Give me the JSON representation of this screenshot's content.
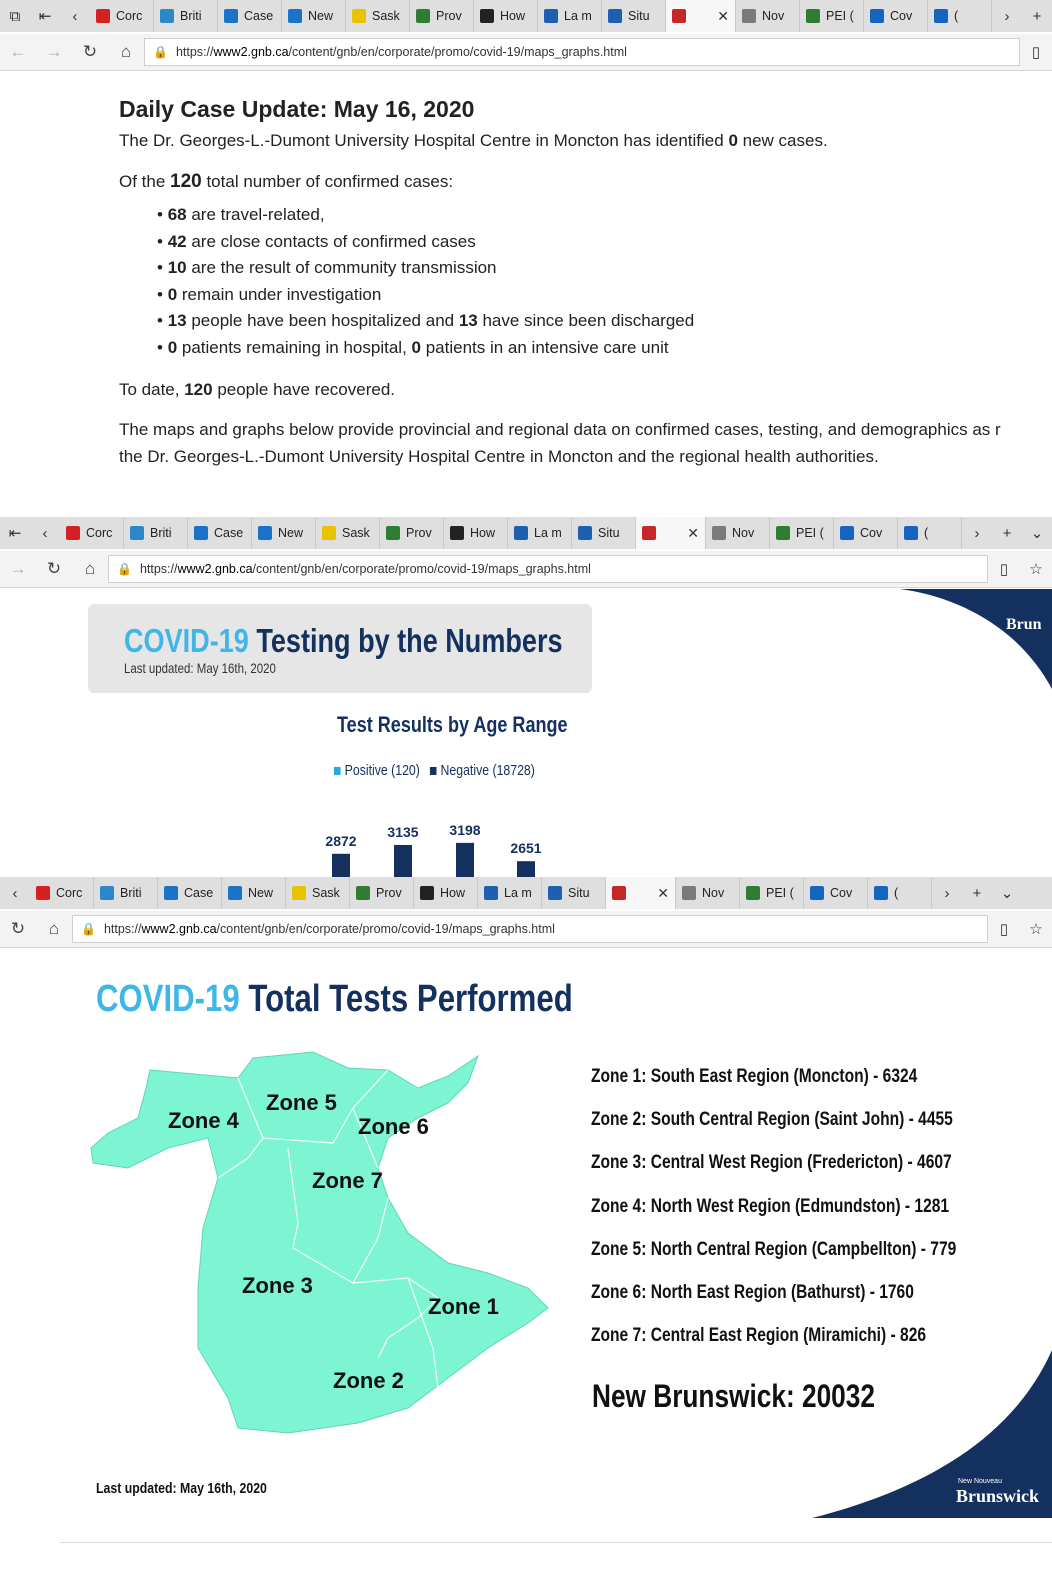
{
  "browser": {
    "tabs": [
      {
        "label": "Corc",
        "color": "#d42020"
      },
      {
        "label": "Briti",
        "color": "#2a88c8"
      },
      {
        "label": "Case",
        "color": "#1a73c9"
      },
      {
        "label": "New",
        "color": "#1a73c9"
      },
      {
        "label": "Sask",
        "color": "#e8c300"
      },
      {
        "label": "Prov",
        "color": "#2e7d32"
      },
      {
        "label": "How",
        "color": "#222222"
      },
      {
        "label": "La m",
        "color": "#1f5fb0"
      },
      {
        "label": "Situ",
        "color": "#1f5fb0"
      },
      {
        "label": "",
        "color": "#c62828",
        "active": true
      },
      {
        "label": "Nov",
        "color": "#7a7a7a"
      },
      {
        "label": "PEI (",
        "color": "#2e7d32"
      },
      {
        "label": "Cov",
        "color": "#1565c0"
      },
      {
        "label": "(",
        "color": "#1565c0"
      }
    ],
    "url_prefix": "https://",
    "url_domain": "www2.gnb.ca",
    "url_path": "/content/gnb/en/corporate/promo/covid-19/maps_graphs.html"
  },
  "update": {
    "heading": "Daily Case Update: May 16, 2020",
    "p1_a": "The Dr. Georges-L.-Dumont University Hospital Centre in Moncton has identified ",
    "p1_b": "0",
    "p1_c": " new cases.",
    "p2_a": "Of the ",
    "p2_b": "120",
    "p2_c": " total number of confirmed cases:",
    "items": [
      {
        "n": "68",
        "t": " are travel-related,"
      },
      {
        "n": "42",
        "t": " are close contacts of confirmed cases"
      },
      {
        "n": "10",
        "t": " are the result of community transmission"
      },
      {
        "n": "0",
        "t": " remain under investigation"
      },
      {
        "n": "13",
        "t": " people have been hospitalized and ",
        "n2": "13",
        "t2": " have since been discharged"
      },
      {
        "n": "0",
        "t": " patients remaining in hospital, ",
        "n2": "0",
        "t2": " patients in an intensive care unit"
      }
    ],
    "p3_a": "To date, ",
    "p3_b": "120",
    "p3_c": " people have recovered.",
    "p4_l1": "The maps and graphs below provide provincial and regional data on confirmed cases, testing, and demographics as r",
    "p4_l2": "the Dr. Georges-L.-Dumont University Hospital Centre in Moncton and the regional health authorities."
  },
  "testing": {
    "title_a": "COVID-19",
    "title_b": " Testing by the Numbers",
    "updated": "Last updated: May 16th, 2020",
    "chart_title": "Test Results by Age Range",
    "legend_pos": "Positive (120)",
    "legend_neg": "Negative (18728)",
    "logo_text": "Brun"
  },
  "chart_data": {
    "type": "bar",
    "title": "Test Results by Age Range",
    "series": [
      {
        "name": "Negative (18728)",
        "values": [
          2872,
          3135,
          3198,
          2651
        ]
      }
    ],
    "colors": {
      "negative": "#13305e",
      "positive": "#29a8e0"
    }
  },
  "tests": {
    "title_a": "COVID-19",
    "title_b": " Total Tests Performed",
    "zones_on_map": [
      "Zone 4",
      "Zone 5",
      "Zone 6",
      "Zone 7",
      "Zone 3",
      "Zone 1",
      "Zone 2"
    ],
    "zone_list": [
      "Zone 1: South East Region (Moncton) - 6324",
      "Zone 2: South Central Region (Saint John) - 4455",
      "Zone 3: Central West Region (Fredericton) - 4607",
      "Zone 4: North West Region (Edmundston) - 1281",
      "Zone 5: North Central Region (Campbellton) - 779",
      "Zone 6: North East Region (Bathurst) - 1760",
      "Zone 7: Central East Region (Miramichi) - 826"
    ],
    "total": "New Brunswick: 20032",
    "updated": "Last updated: May 16th, 2020",
    "logo_small": "New Nouveau",
    "logo_text": "Brunswick",
    "map_color": "#7df5d2",
    "title_accent": "#3fb6e8",
    "dark_blue": "#13305e"
  }
}
